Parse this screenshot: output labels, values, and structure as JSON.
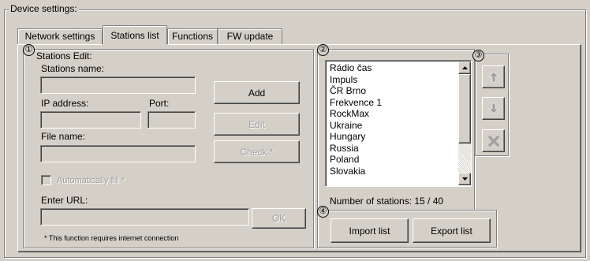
{
  "device_settings": {
    "title": "Device settings:"
  },
  "tabs": [
    {
      "label": "Network settings"
    },
    {
      "label": "Stations list"
    },
    {
      "label": "Functions"
    },
    {
      "label": "FW update"
    }
  ],
  "markers": [
    "①",
    "②",
    "③",
    "④"
  ],
  "stations_edit": {
    "title": "Stations Edit:",
    "name_label": "Stations name:",
    "name_value": "",
    "ip_label": "IP address:",
    "ip_value": "",
    "port_label": "Port:",
    "port_value": "",
    "file_label": "File name:",
    "file_value": "",
    "add_label": "Add",
    "edit_label": "Edit",
    "check_label": "Check *",
    "autofill_label": "Automatically fill *",
    "url_label": "Enter URL:",
    "url_value": "",
    "ok_label": "OK",
    "footnote": "* This function requires internet connection"
  },
  "stations_list": {
    "items": [
      "Rádio čas",
      "Impuls",
      "ČR Brno",
      "Frekvence 1",
      "RockMax",
      "Ukraine",
      "Hungary",
      "Russia",
      "Poland",
      "Slovakia"
    ],
    "count_text": "Number of stations: 15 / 40"
  },
  "import_export": {
    "import_label": "Import list",
    "export_label": "Export list"
  },
  "icons": {
    "up": "arrow-up-icon",
    "down": "arrow-down-icon",
    "delete": "delete-x-icon"
  },
  "colors": {
    "face": "#d4d0c8",
    "shadow": "#808080",
    "highlight": "#ffffff",
    "disabled": "#a0a0a0"
  }
}
